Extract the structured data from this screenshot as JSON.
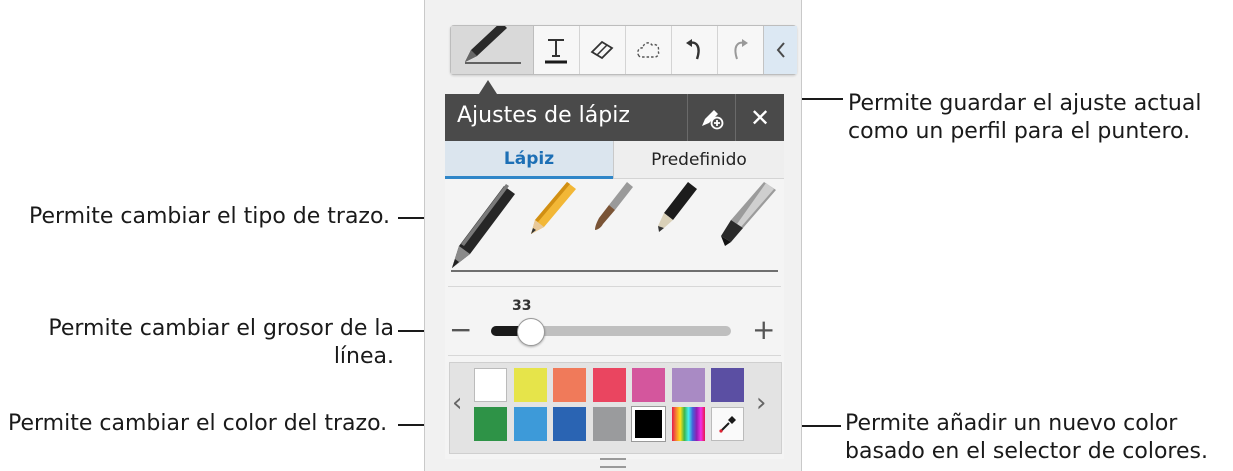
{
  "callouts": {
    "save_profile": [
      "Permite guardar el ajuste actual",
      "como un perfil para el puntero."
    ],
    "stroke_type": "Permite cambiar el tipo de trazo.",
    "line_thickness": [
      "Permite cambiar el grosor de la",
      "línea."
    ],
    "stroke_color": "Permite cambiar el color del trazo.",
    "add_color": [
      "Permite añadir un nuevo color",
      "basado en el selector de colores."
    ]
  },
  "panel": {
    "title": "Ajustes de lápiz",
    "close_label": "✕",
    "tabs": [
      {
        "label": "Lápiz",
        "active": true
      },
      {
        "label": "Predefinido",
        "active": false
      }
    ]
  },
  "toolbar": {
    "tools": [
      "pen-icon",
      "text-icon",
      "eraser-icon",
      "lasso-icon",
      "undo-icon",
      "redo-icon",
      "collapse-icon"
    ]
  },
  "pens": [
    "pen",
    "pencil",
    "brush",
    "marker",
    "calligraphy-pen"
  ],
  "thickness": {
    "value": "33",
    "minus": "−",
    "plus": "+",
    "fraction": 0.15
  },
  "palette": {
    "row1": [
      "#ffffff",
      "#e6e44a",
      "#f07a5a",
      "#ea4560",
      "#d4569d",
      "#a98ac4",
      "#5b4fa3"
    ],
    "row2": [
      "#2e9347",
      "#3d9ad9",
      "#2a64b3",
      "#9a9b9d",
      "#000000",
      "spectrum",
      "eyedropper"
    ],
    "selected": "#000000",
    "prev_arrow": "‹",
    "next_arrow": "›"
  },
  "colors": {
    "accent": "#1d6fb5",
    "header_bg": "#4a4a4a",
    "leader_line": "#1a1a1a"
  }
}
